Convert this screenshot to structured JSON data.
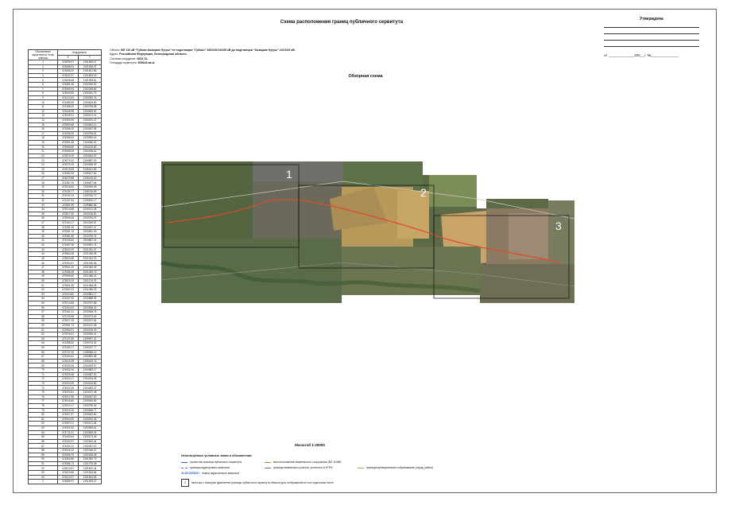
{
  "title": "Схема расположения границ публичного сервитута",
  "approved": {
    "title": "Утверждена",
    "date_line": "от _____________202__г. №______________"
  },
  "meta": {
    "object_label": "Объект:",
    "object_value": "ВЛ 110 кВ \"Губкин-Казацкие бугры\" от подстанции \"Губкин\" 330/220/110/35 кВ до подстанции \"Казацкие бугры\" 110/10/6 кВ.",
    "address_label": "Адрес:",
    "address_value": "Российская Федерация, Белгородская область.",
    "crs_label": "Система координат:",
    "crs_value": "МСК 31.",
    "area_label": "Площадь сервитута:",
    "area_value": "505643 кв.м."
  },
  "table": {
    "h_point": "Обозначение характерных точек границы",
    "h_coords": "Координаты",
    "h_x": "X",
    "h_y": "Y",
    "rows": [
      [
        "1",
        "474659.97",
        "2191505.37"
      ],
      [
        "2",
        "474658.51",
        "2191535.37"
      ],
      [
        "3",
        "474658.32",
        "2191601.86"
      ],
      [
        "4",
        "474632.37",
        "2191805.09"
      ],
      [
        "5",
        "474606.48",
        "2191995.61"
      ],
      [
        "6",
        "474581.96",
        "2192090.30"
      ],
      [
        "7",
        "474559.94",
        "2192265.69"
      ],
      [
        "8",
        "474509.83",
        "2192481.79"
      ],
      [
        "9",
        "474413.94",
        "2193280.76"
      ],
      [
        "10",
        "474485.55",
        "2193634.80"
      ],
      [
        "11",
        "474286.02",
        "2193796.98"
      ],
      [
        "12",
        "474945.98",
        "2193505.90"
      ],
      [
        "13",
        "474949.11",
        "2193121.21"
      ],
      [
        "14",
        "474950.93",
        "2193291.47"
      ],
      [
        "15",
        "474953.56",
        "2193462.10"
      ],
      [
        "16",
        "474956.25",
        "2193637.98"
      ],
      [
        "17",
        "474959.26",
        "2193796.81"
      ],
      [
        "18",
        "474958.53",
        "2193950.16"
      ],
      [
        "19",
        "474961.68",
        "2194066.40"
      ],
      [
        "20",
        "474965.80",
        "2194126.80"
      ],
      [
        "21",
        "474968.35",
        "2194326.62"
      ],
      [
        "22",
        "474970.09",
        "2194543.97"
      ],
      [
        "23",
        "474970.22",
        "2194587.09"
      ],
      [
        "24",
        "474970.19",
        "2194906.09"
      ],
      [
        "25",
        "474978.55",
        "2195181.89"
      ],
      [
        "26",
        "474982.30",
        "2195437.80"
      ],
      [
        "27",
        "474879.88",
        "2196105.30"
      ],
      [
        "28",
        "474387.25",
        "2196907.64"
      ],
      [
        "29",
        "473618.82",
        "2198309.45"
      ],
      [
        "30",
        "473435.77",
        "2198745.59"
      ],
      [
        "31",
        "473232.10",
        "2199760.72"
      ],
      [
        "32",
        "473137.64",
        "2199940.17"
      ],
      [
        "33",
        "472851.89",
        "2199882.85"
      ],
      [
        "34",
        "473014.68",
        "2200131.28"
      ],
      [
        "35",
        "472817.90",
        "2200136.50"
      ],
      [
        "36",
        "473096.45",
        "2200234.07"
      ],
      [
        "37",
        "473164.17",
        "2200240.87"
      ],
      [
        "38",
        "473281.05",
        "2200497.47"
      ],
      [
        "39",
        "473351.76",
        "2200581.09"
      ],
      [
        "40",
        "473361.80",
        "2200745.74"
      ],
      [
        "41",
        "473226.60",
        "2200867.24"
      ],
      [
        "42",
        "473457.08",
        "2200991.74"
      ],
      [
        "43",
        "473522.09",
        "2201051.47"
      ],
      [
        "44",
        "473664.48",
        "2201030.95"
      ],
      [
        "45",
        "473833.68",
        "2201004.76"
      ],
      [
        "46",
        "473994.97",
        "2201045.56"
      ],
      [
        "47",
        "473941.30",
        "2201084.49"
      ],
      [
        "48",
        "473956.28",
        "2201083.79"
      ],
      [
        "49",
        "473955.60",
        "2201088.42"
      ],
      [
        "50",
        "473820.29",
        "2201176.79"
      ],
      [
        "51",
        "473661.55",
        "2201068.38"
      ],
      [
        "52",
        "472502.22",
        "2201056.29"
      ],
      [
        "53",
        "473424.80",
        "2200981.17"
      ],
      [
        "54",
        "473337.06",
        "2200888.39"
      ],
      [
        "55",
        "473214.86",
        "2200757.88"
      ],
      [
        "56",
        "473254.53",
        "2200658.42"
      ],
      [
        "57",
        "473162.21",
        "2200468.76"
      ],
      [
        "58",
        "473130.96",
        "2200273.62"
      ],
      [
        "59",
        "473027.25",
        "2200237.64"
      ],
      [
        "60",
        "472981.74",
        "2200137.38"
      ],
      [
        "61",
        "472960.01",
        "2200126.29"
      ],
      [
        "62",
        "472915.91",
        "2200053.41"
      ],
      [
        "63",
        "473137.65",
        "2199957.42"
      ],
      [
        "64",
        "473288.52",
        "2199743.32"
      ],
      [
        "65",
        "473359.17",
        "2199237.77"
      ],
      [
        "66",
        "473737.05",
        "2198396.13"
      ],
      [
        "67",
        "474344.61",
        "2196890.38"
      ],
      [
        "68",
        "474816.36",
        "2195440.76"
      ],
      [
        "69",
        "474930.05",
        "2194929.97"
      ],
      [
        "70",
        "474932.34",
        "2194582.17"
      ],
      [
        "71",
        "474925.58",
        "2194487.09"
      ],
      [
        "72",
        "474924.17",
        "2194315.95"
      ],
      [
        "73",
        "474924.09",
        "2194144.80"
      ],
      [
        "74",
        "474922.06",
        "2194283.37"
      ],
      [
        "75",
        "474920.81",
        "2194237.08"
      ],
      [
        "76",
        "474917.69",
        "2194067.00"
      ],
      [
        "77",
        "474915.80",
        "2193930.80"
      ],
      [
        "78",
        "474913.17",
        "2193795.35"
      ],
      [
        "79",
        "474910.25",
        "2193638.77"
      ],
      [
        "80",
        "474907.57",
        "2193462.80"
      ],
      [
        "81",
        "474904.90",
        "2193292.08"
      ],
      [
        "82",
        "474903.11",
        "2193121.84"
      ],
      [
        "83",
        "474900.30",
        "2192955.51"
      ],
      [
        "84",
        "474711.51",
        "2192835.33"
      ],
      [
        "85",
        "474460.64",
        "2192673.46"
      ],
      [
        "86",
        "474330.37",
        "2192500.44"
      ],
      [
        "87",
        "474420.11",
        "2192457.13"
      ],
      [
        "88",
        "474516.10",
        "2192346.07"
      ],
      [
        "89",
        "474536.79",
        "2192186.35"
      ],
      [
        "90",
        "474560.86",
        "2191990.73"
      ],
      [
        "91",
        "474586.74",
        "2191799.38"
      ],
      [
        "92",
        "474613.97",
        "2191600.34"
      ],
      [
        "93",
        "474613.66",
        "2191534.84"
      ],
      [
        "94",
        "474613.97",
        "2191504.65"
      ],
      [
        "1",
        "474659.97",
        "2191505.37"
      ]
    ]
  },
  "map": {
    "overview_title": "Обзорная схема",
    "fragments": [
      "1",
      "2",
      "3"
    ]
  },
  "scale": "Масштаб 1:25000",
  "legend": {
    "title": "Используемые условные знаки и обозначения:",
    "items": {
      "servitude": "проектная граница публичного сервитута",
      "cadastral": "граница кадастрового квартала",
      "code_value": "31:03:0101001",
      "code_desc": "номер кадастрового квартала",
      "engineering": "местоположение инженерного сооружения (ВЛ 110кВ)",
      "egrn": "граница земельного участка, учтенного в ЕГРН",
      "municipal": "граница муниципального образования (город, район)",
      "fragment_box": "1",
      "fragment": "выноска с номером фрагмента границы публичного сервитута объекта для отображения его на отдельном листе"
    }
  },
  "colors": {
    "servitude": "#3355cc",
    "cadastral": "#5577aa",
    "engineering": "#dd7733",
    "egrn": "#5577aa",
    "municipal": "#88bb44"
  }
}
